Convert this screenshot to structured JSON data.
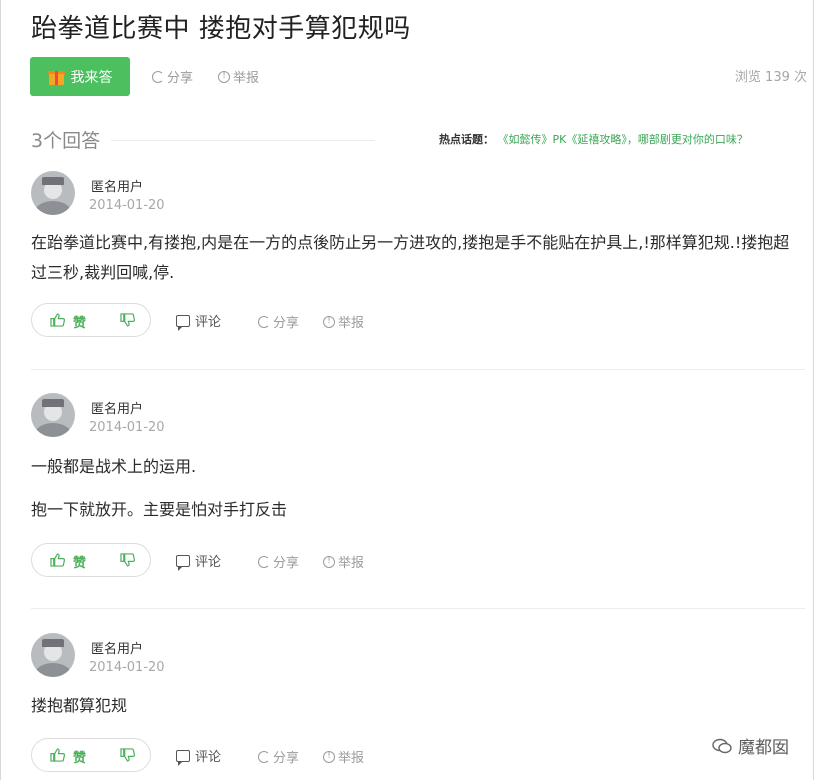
{
  "question": {
    "title": "跆拳道比赛中 搂抱对手算犯规吗",
    "answer_button": "我来答",
    "share": "分享",
    "report": "举报",
    "views": "浏览 139 次"
  },
  "answers_header": {
    "count": "3个回答",
    "hot_label": "热点话题：",
    "hot_topic": "《如懿传》PK《延禧攻略》，哪部剧更对你的口味？"
  },
  "answers": [
    {
      "user": "匿名用户",
      "date": "2014-01-20",
      "paragraphs": [
        "在跆拳道比赛中,有搂抱,内是在一方的点後防止另一方进攻的,搂抱是手不能贴在护具上,!那样算犯规.!搂抱超过三秒,裁判回喊,停."
      ],
      "like": "赞",
      "comment": "评论",
      "share": "分享",
      "report": "举报"
    },
    {
      "user": "匿名用户",
      "date": "2014-01-20",
      "paragraphs": [
        "一般都是战术上的运用.",
        "抱一下就放开。主要是怕对手打反击"
      ],
      "like": "赞",
      "comment": "评论",
      "share": "分享",
      "report": "举报"
    },
    {
      "user": "匿名用户",
      "date": "2014-01-20",
      "paragraphs": [
        "搂抱都算犯规"
      ],
      "like": "赞",
      "comment": "评论",
      "share": "分享",
      "report": "举报"
    }
  ],
  "watermark": "魔都囡",
  "colors": {
    "accent": "#4cc05f",
    "link": "#3aa757",
    "muted": "#9b9b9b"
  },
  "icons": [
    "gift-icon",
    "share-icon",
    "report-icon",
    "thumbs-up-icon",
    "thumbs-down-icon",
    "comment-icon",
    "wechat-icon"
  ]
}
